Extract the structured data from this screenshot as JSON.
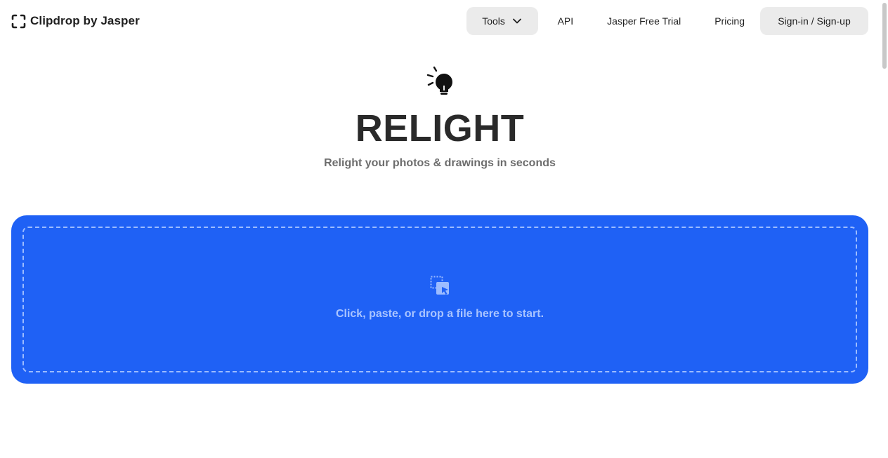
{
  "brand": {
    "name": "Clipdrop by Jasper"
  },
  "nav": {
    "tools_label": "Tools",
    "api_label": "API",
    "trial_label": "Jasper Free Trial",
    "pricing_label": "Pricing",
    "signin_label": "Sign-in / Sign-up"
  },
  "hero": {
    "icon": "lightbulb-icon",
    "title": "RELIGHT",
    "subtitle": "Relight your photos & drawings in seconds"
  },
  "dropzone": {
    "icon": "file-drop-icon",
    "text": "Click, paste, or drop a file here to start."
  },
  "colors": {
    "accent": "#1f61f5",
    "dropzone_border": "#9cbcff",
    "button_gray": "#ebebeb"
  }
}
